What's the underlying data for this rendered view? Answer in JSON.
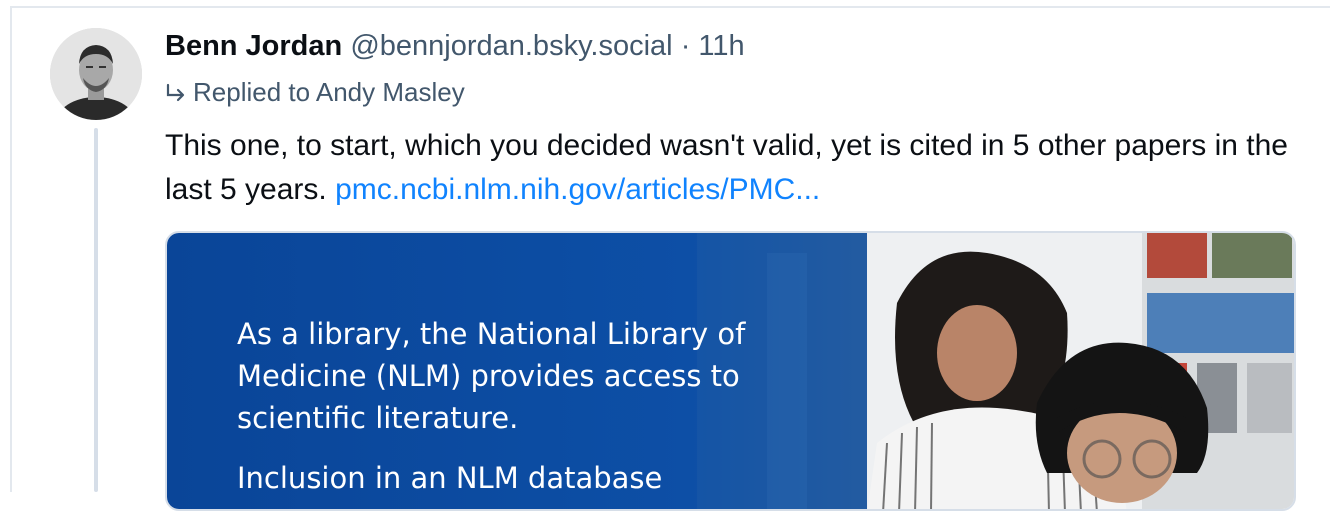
{
  "post": {
    "author_name": "Benn Jordan",
    "author_handle": "@bennjordan.bsky.social",
    "separator": "·",
    "time_ago": "11h",
    "reply_icon": "reply-arrow-icon",
    "reply_text": "Replied to Andy Masley",
    "body_text": "This one, to start, which you decided wasn't valid, yet is cited in 5 other papers in the last 5 years.",
    "link_text": "pmc.ncbi.nlm.nih.gov/articles/PMC..."
  },
  "link_card": {
    "paragraph_1": "As a library, the National Library of Medicine (NLM) provides access to scientific literature.",
    "paragraph_2": "Inclusion in an NLM database"
  },
  "colors": {
    "text_primary": "#0b0f14",
    "text_secondary": "#42576c",
    "link": "#1083fe",
    "card_blue": "#0b4ea3",
    "thread_line": "#d6dee8"
  }
}
